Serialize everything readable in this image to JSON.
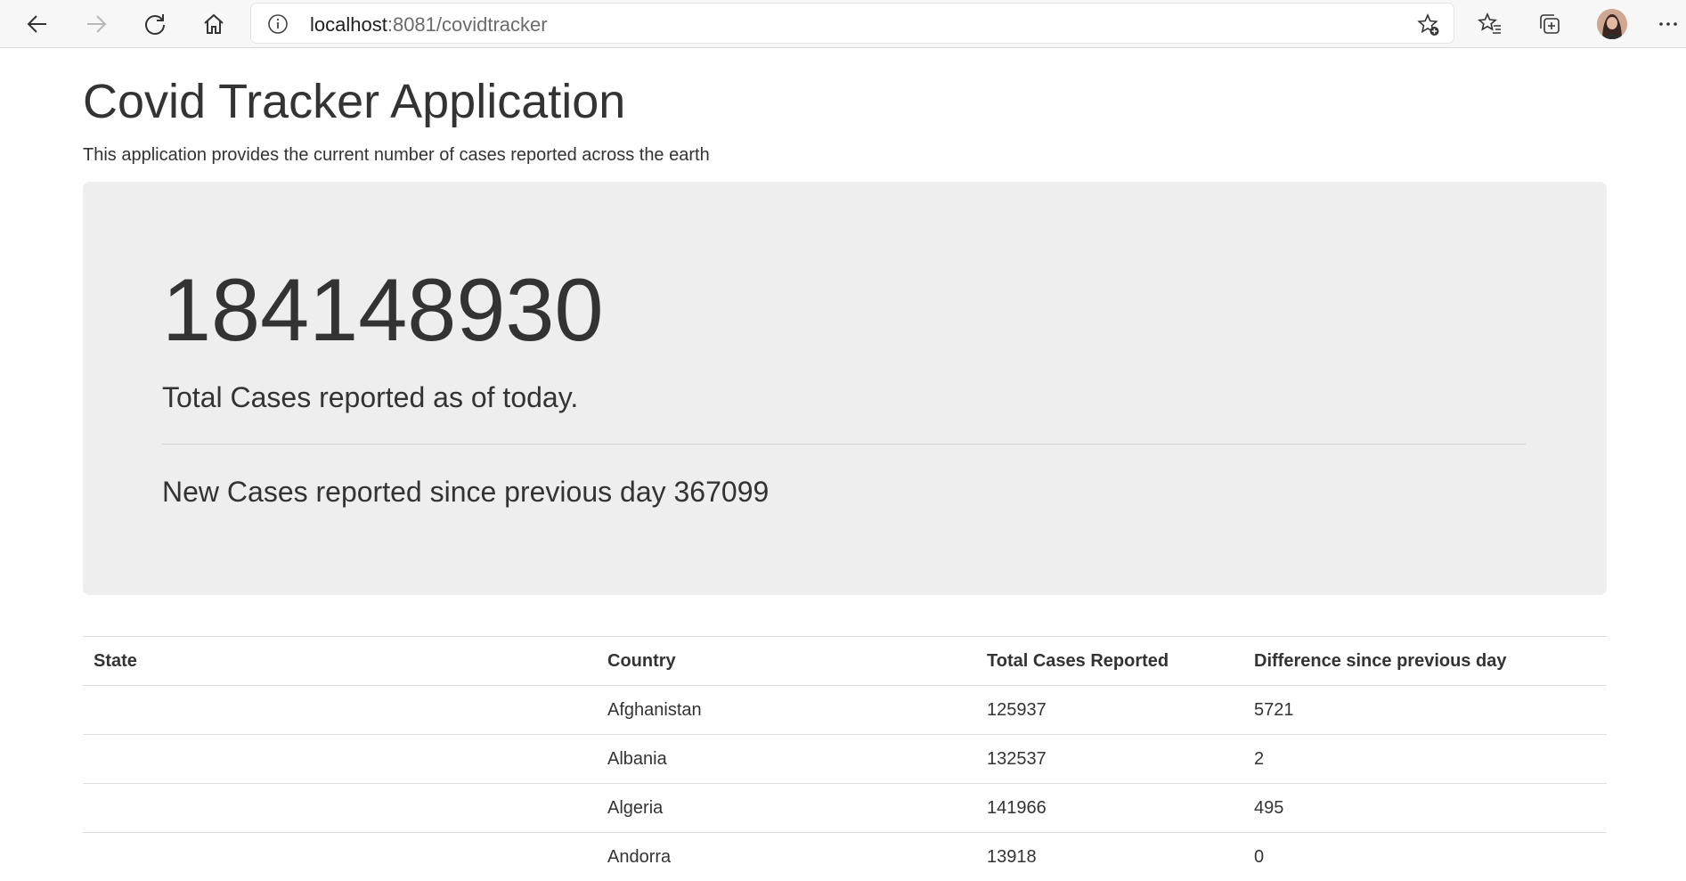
{
  "browser": {
    "url_host": "localhost",
    "url_path": ":8081/covidtracker"
  },
  "page": {
    "title": "Covid Tracker Application",
    "subtitle": "This application provides the current number of cases reported across the earth"
  },
  "summary": {
    "total_cases": "184148930",
    "total_label": "Total Cases reported as of today.",
    "new_cases_text": "New Cases reported since previous day 367099"
  },
  "table": {
    "headers": [
      "State",
      "Country",
      "Total Cases Reported",
      "Difference since previous day"
    ],
    "rows": [
      {
        "state": "",
        "country": "Afghanistan",
        "total": "125937",
        "diff": "5721"
      },
      {
        "state": "",
        "country": "Albania",
        "total": "132537",
        "diff": "2"
      },
      {
        "state": "",
        "country": "Algeria",
        "total": "141966",
        "diff": "495"
      },
      {
        "state": "",
        "country": "Andorra",
        "total": "13918",
        "diff": "0"
      }
    ]
  }
}
